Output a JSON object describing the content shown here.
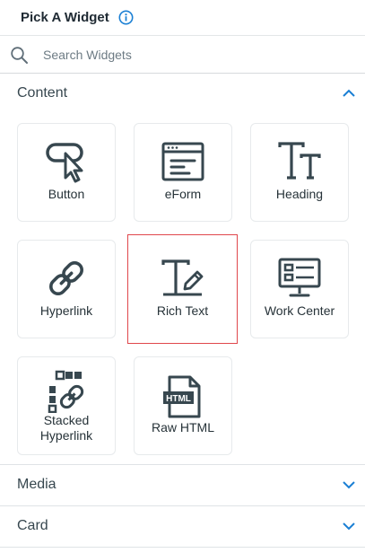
{
  "header": {
    "title": "Pick A Widget",
    "info_icon": "info-circle-icon"
  },
  "search": {
    "placeholder": "Search Widgets",
    "value": ""
  },
  "sections": {
    "content": {
      "label": "Content",
      "expanded": true
    },
    "media": {
      "label": "Media",
      "expanded": false
    },
    "card": {
      "label": "Card",
      "expanded": false
    }
  },
  "widgets": [
    {
      "label": "Button",
      "icon": "button-cursor-icon"
    },
    {
      "label": "eForm",
      "icon": "eform-window-icon"
    },
    {
      "label": "Heading",
      "icon": "heading-tt-icon"
    },
    {
      "label": "Hyperlink",
      "icon": "link-chain-icon"
    },
    {
      "label": "Rich Text",
      "icon": "rich-text-pen-icon",
      "selected": true
    },
    {
      "label": "Work Center",
      "icon": "work-center-monitor-icon"
    },
    {
      "label": "Stacked Hyperlink",
      "line1": "Stacked",
      "line2": "Hyperlink",
      "icon": "stacked-link-icon"
    },
    {
      "label": "Raw HTML",
      "icon": "html-file-icon"
    }
  ],
  "colors": {
    "accent": "#1a7fd4",
    "selected_border": "#e0474c",
    "icon": "#37474f"
  }
}
